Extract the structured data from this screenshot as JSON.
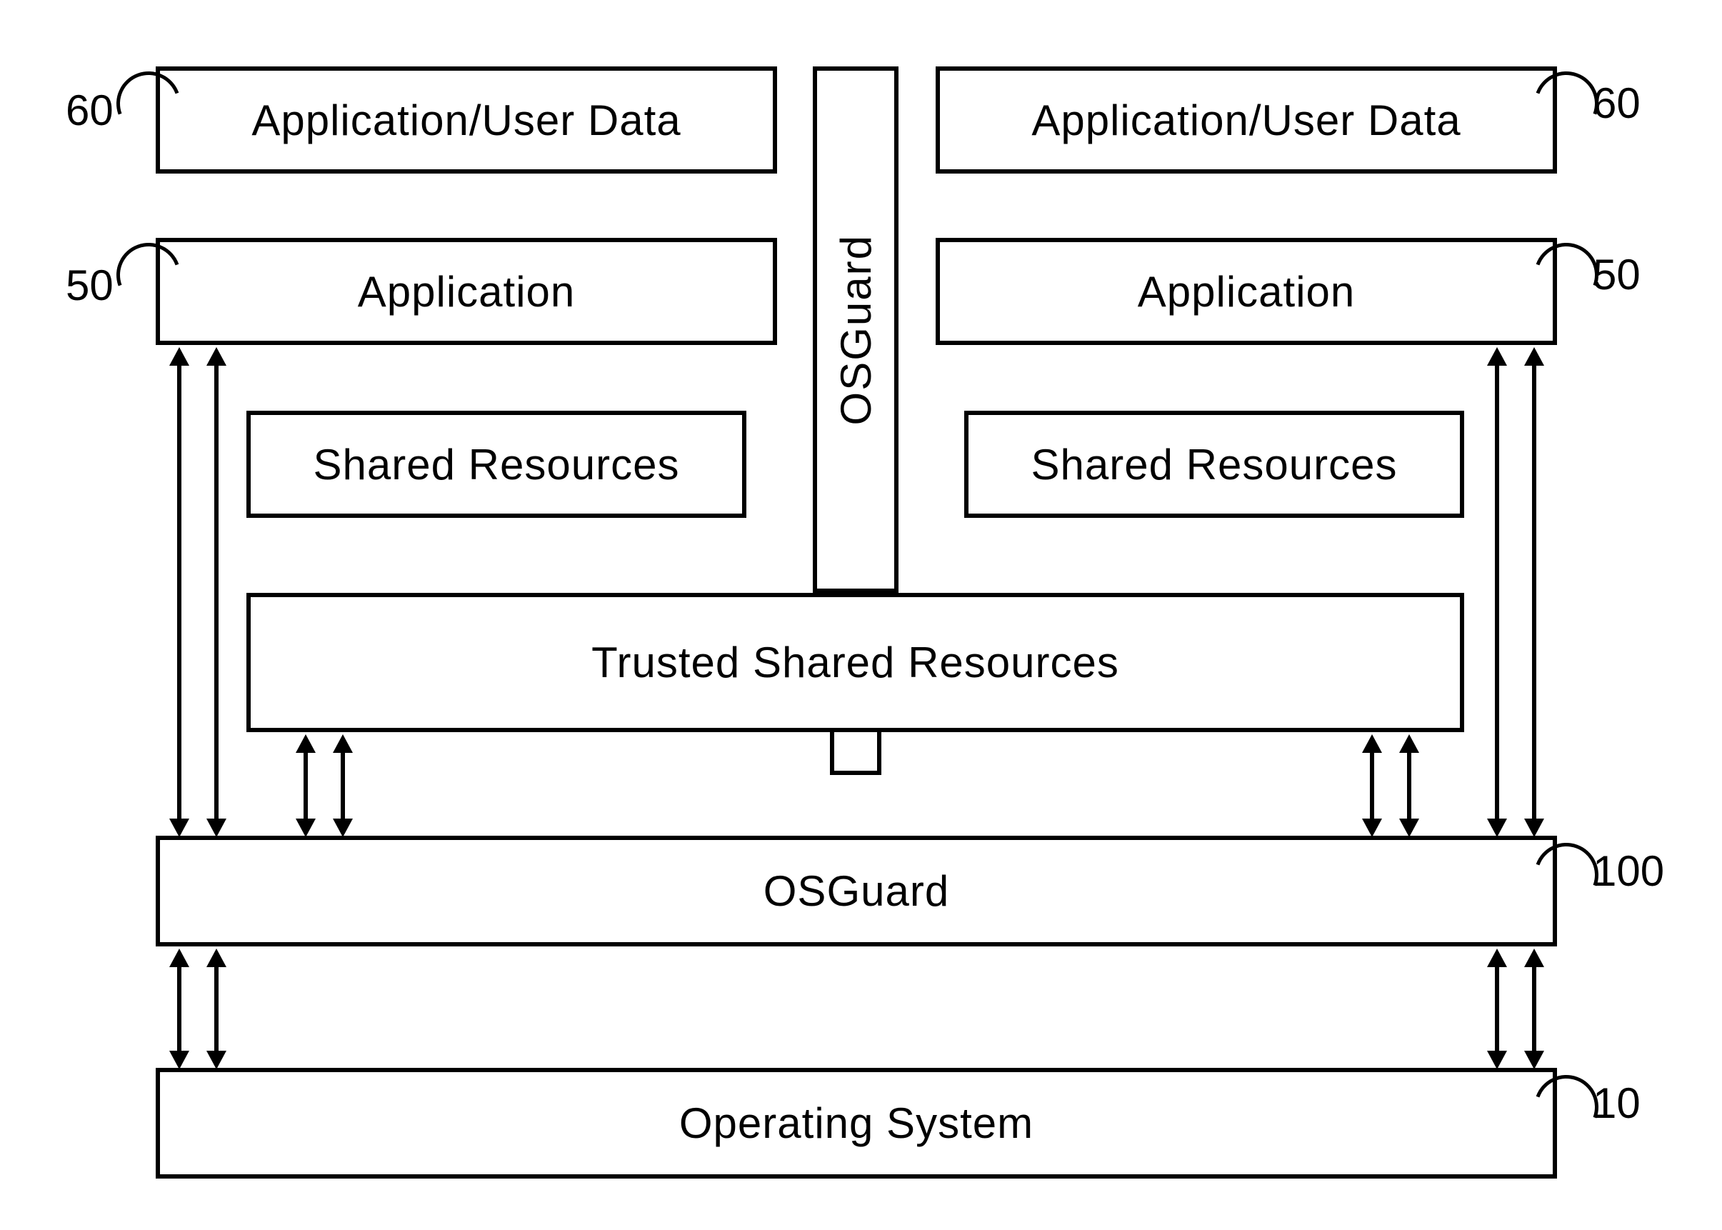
{
  "labels": {
    "app_user_data_left": "Application/User Data",
    "app_user_data_right": "Application/User Data",
    "application_left": "Application",
    "application_right": "Application",
    "shared_res_left": "Shared Resources",
    "shared_res_right": "Shared Resources",
    "trusted_shared": "Trusted Shared Resources",
    "osguard_vertical": "OSGuard",
    "osguard_horizontal": "OSGuard",
    "os": "Operating System"
  },
  "refs": {
    "r60a": "60",
    "r60b": "60",
    "r50a": "50",
    "r50b": "50",
    "r100": "100",
    "r10": "10"
  }
}
